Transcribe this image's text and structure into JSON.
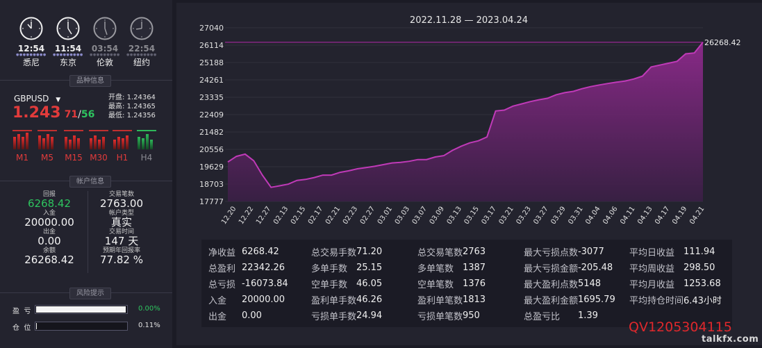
{
  "clocks": [
    {
      "time": "12:54",
      "city": "悉尼",
      "active": true
    },
    {
      "time": "11:54",
      "city": "东京",
      "active": true
    },
    {
      "time": "03:54",
      "city": "伦敦",
      "active": false
    },
    {
      "time": "22:54",
      "city": "纽约",
      "active": false
    }
  ],
  "product": {
    "section_title": "品种信息",
    "symbol": "GBPUSD",
    "price_main": "1.243",
    "price_bid": "71",
    "price_sep": "/",
    "price_ask": "56",
    "open_label": "开盘:",
    "open": "1.24364",
    "high_label": "最高:",
    "high": "1.24365",
    "low_label": "最低:",
    "low": "1.24356",
    "timeframes": [
      "M1",
      "M5",
      "M15",
      "M30",
      "H1",
      "H4"
    ]
  },
  "account": {
    "section_title": "帐户信息",
    "return_label": "回报",
    "return_value": "6268.42",
    "trades_label": "交易笔数",
    "trades_value": "2763.00",
    "deposit_label": "入金",
    "deposit_value": "20000.00",
    "type_label": "帐户类型",
    "type_value": "真实",
    "withdraw_label": "出金",
    "withdraw_value": "0.00",
    "time_label": "交易时间",
    "time_value": "147 天",
    "balance_label": "余额",
    "balance_value": "26268.42",
    "annual_label": "预期年回报率",
    "annual_value": "77.82 %"
  },
  "risk": {
    "section_title": "风险提示",
    "pl_label": "盈  亏",
    "pl_value": "0.00%",
    "pl_fill": 0.99,
    "pos_label": "仓  位",
    "pos_value": "0.11%",
    "pos_fill": 0.0011
  },
  "chart_data": {
    "type": "area",
    "title": "2022.11.28 — 2023.04.24",
    "y_ticks": [
      "27040",
      "26114",
      "25188",
      "24261",
      "23335",
      "22409",
      "21482",
      "20556",
      "19629",
      "18703",
      "17777"
    ],
    "ylim": [
      17777,
      27040
    ],
    "x_ticks": [
      "12.20",
      "12.22",
      "12.27",
      "02.13",
      "02.15",
      "02.17",
      "02.21",
      "02.23",
      "02.27",
      "03.01",
      "03.03",
      "03.07",
      "03.09",
      "03.13",
      "03.15",
      "03.17",
      "03.21",
      "03.23",
      "03.27",
      "03.29",
      "03.31",
      "04.04",
      "04.06",
      "04.11",
      "04.13",
      "04.17",
      "04.19",
      "04.21"
    ],
    "last_value_label": "26268.42",
    "series": [
      {
        "values": [
          19880,
          20180,
          20300,
          19950,
          19180,
          18530,
          18610,
          18700,
          18900,
          18950,
          19050,
          19180,
          19180,
          19330,
          19410,
          19520,
          19580,
          19650,
          19740,
          19830,
          19860,
          19920,
          20010,
          20010,
          20150,
          20220,
          20500,
          20720,
          20900,
          21010,
          21220,
          22600,
          22650,
          22860,
          22980,
          23100,
          23200,
          23280,
          23470,
          23580,
          23650,
          23790,
          23900,
          23990,
          24070,
          24140,
          24200,
          24310,
          24460,
          24950,
          25050,
          25150,
          25250,
          25650,
          25700,
          26268.42
        ],
        "color": "#b02aa6"
      }
    ]
  },
  "stats": [
    [
      {
        "k": "净收益",
        "v": "6268.42"
      },
      {
        "k": "总交易手数",
        "v": "71.20"
      },
      {
        "k": "总交易笔数",
        "v": "2763"
      },
      {
        "k": "最大亏损点数",
        "v": "-3077"
      },
      {
        "k": "平均日收益",
        "v": "111.94"
      }
    ],
    [
      {
        "k": "总盈利",
        "v": "22342.26"
      },
      {
        "k": "多单手数",
        "v": "25.15"
      },
      {
        "k": "多单笔数",
        "v": "1387"
      },
      {
        "k": "最大亏损金额",
        "v": "-205.48"
      },
      {
        "k": "平均周收益",
        "v": "298.50"
      }
    ],
    [
      {
        "k": "总亏损",
        "v": "-16073.84"
      },
      {
        "k": "空单手数",
        "v": "46.05"
      },
      {
        "k": "空单笔数",
        "v": "1376"
      },
      {
        "k": "最大盈利点数",
        "v": "5148"
      },
      {
        "k": "平均月收益",
        "v": "1253.68"
      }
    ],
    [
      {
        "k": "入金",
        "v": "20000.00"
      },
      {
        "k": "盈利单手数",
        "v": "46.26"
      },
      {
        "k": "盈利单笔数",
        "v": "1813"
      },
      {
        "k": "最大盈利金额",
        "v": "1695.79"
      },
      {
        "k": "平均持仓时间",
        "v": "6.43小时"
      }
    ],
    [
      {
        "k": "出金",
        "v": "0.00"
      },
      {
        "k": "亏损单手数",
        "v": "24.94"
      },
      {
        "k": "亏损单笔数",
        "v": "950"
      },
      {
        "k": "总盈亏比",
        "v": "1.39"
      }
    ]
  ],
  "watermark": "QV1205304115",
  "site": "talkfx.com",
  "colors": {
    "accent": "#b02aa6",
    "red": "#e23b3b",
    "green": "#2ec45f",
    "panel": "#23232e",
    "bg": "#1b1b25"
  }
}
